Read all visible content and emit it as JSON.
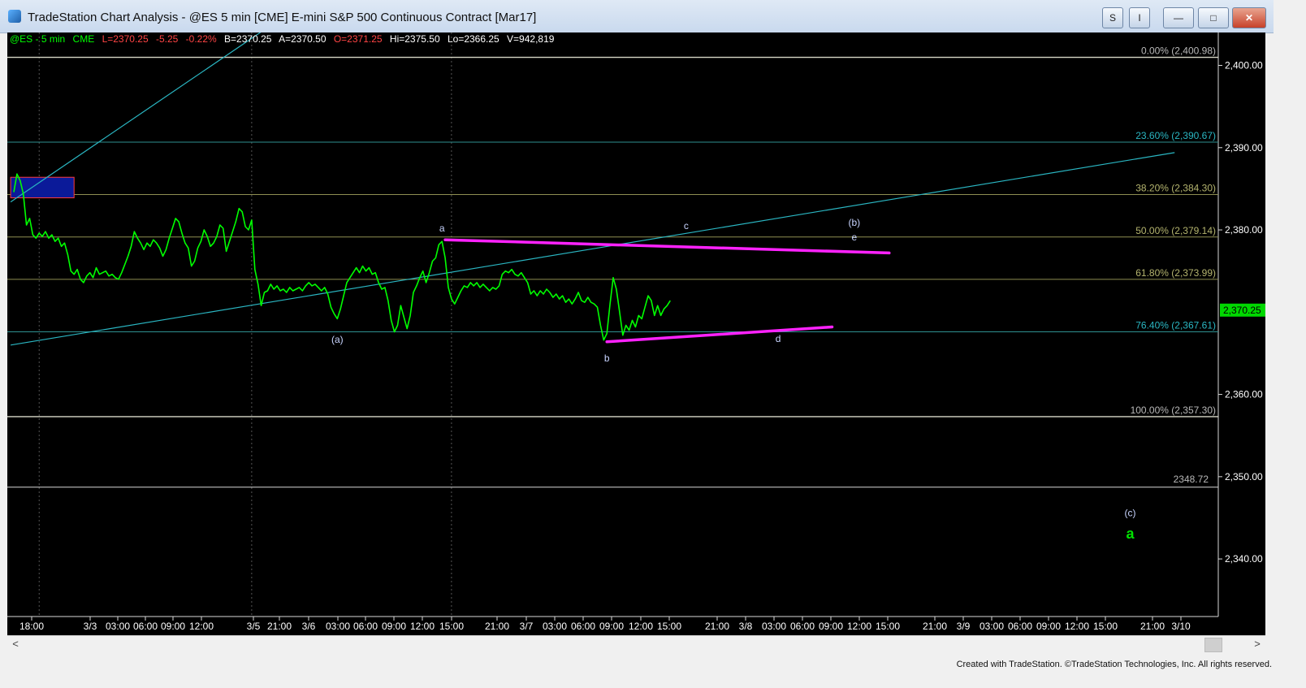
{
  "window": {
    "title": "TradeStation Chart Analysis - @ES 5 min [CME] E-mini S&P 500 Continuous Contract [Mar17]",
    "s_label": "S",
    "i_label": "I",
    "minimize_label": "—",
    "maximize_label": "□",
    "close_label": "✕"
  },
  "colors": {
    "price": "#00ff00",
    "trend": "#2ab6c2",
    "pink": "#ff22ff",
    "fib": "#b4b46e",
    "label": "#c8d4ff"
  },
  "header": {
    "symbol": "@ES - 5 min",
    "exchange": "CME",
    "last": "L=2370.25",
    "change": "-5.25",
    "pct": "-0.22%",
    "bid": "B=2370.25",
    "ask": "A=2370.50",
    "open": "O=2371.25",
    "high": "Hi=2375.50",
    "low": "Lo=2366.25",
    "volume": "V=942,819"
  },
  "scroll": {
    "left": "<",
    "right": ">"
  },
  "footer": {
    "text": "Created with TradeStation. ©TradeStation Technologies, Inc. All rights reserved."
  },
  "chart_data": {
    "type": "line",
    "ylim": [
      2333,
      2404
    ],
    "y_ticks": [
      {
        "value": 2400,
        "label": "2,400.00"
      },
      {
        "value": 2390,
        "label": "2,390.00"
      },
      {
        "value": 2380,
        "label": "2,380.00"
      },
      {
        "value": 2360,
        "label": "2,360.00"
      },
      {
        "value": 2350,
        "label": "2,350.00"
      },
      {
        "value": 2340,
        "label": "2,340.00"
      }
    ],
    "x_ticks": [
      "18:00",
      "3/3",
      "03:00",
      "06:00",
      "09:00",
      "12:00",
      "3/5",
      "21:00",
      "3/6",
      "03:00",
      "06:00",
      "09:00",
      "12:00",
      "15:00",
      "21:00",
      "3/7",
      "03:00",
      "06:00",
      "09:00",
      "12:00",
      "15:00",
      "21:00",
      "3/8",
      "03:00",
      "06:00",
      "09:00",
      "12:00",
      "15:00",
      "21:00",
      "3/9",
      "03:00",
      "06:00",
      "09:00",
      "12:00",
      "15:00",
      "21:00",
      "3/10"
    ],
    "last_price": {
      "value": 2370.25,
      "label": "2,370.25"
    },
    "fib_levels": [
      {
        "value": 2400.98,
        "label": "0.00% (2,400.98)"
      },
      {
        "value": 2390.67,
        "label": "23.60% (2,390.67)"
      },
      {
        "value": 2384.3,
        "label": "38.20% (2,384.30)"
      },
      {
        "value": 2379.14,
        "label": "50.00% (2,379.14)"
      },
      {
        "value": 2373.99,
        "label": "61.80% (2,373.99)"
      },
      {
        "value": 2367.61,
        "label": "76.40% (2,367.61)"
      },
      {
        "value": 2357.3,
        "label": "100.00% (2,357.30)"
      }
    ],
    "extra_level": {
      "value": 2348.72,
      "label": "2348.72"
    },
    "wave_labels": [
      {
        "text": "a",
        "bar": 135,
        "y": 2379.8
      },
      {
        "text": "(a)",
        "bar": 102,
        "y": 2366.3
      },
      {
        "text": "b",
        "bar": 187,
        "y": 2364.0
      },
      {
        "text": "c",
        "bar": 212,
        "y": 2380.1
      },
      {
        "text": "(b)",
        "bar": 265,
        "y": 2380.5
      },
      {
        "text": "e",
        "bar": 265,
        "y": 2378.7
      },
      {
        "text": "d",
        "bar": 241,
        "y": 2366.4
      },
      {
        "text": "(c)",
        "bar": 352,
        "y": 2345.2
      },
      {
        "text": "a",
        "bar": 352,
        "y": 2342.5
      }
    ],
    "price_series": [
      [
        0,
        2384.6
      ],
      [
        1,
        2386.8
      ],
      [
        2,
        2386.0
      ],
      [
        3,
        2384.4
      ],
      [
        4,
        2380.6
      ],
      [
        5,
        2381.4
      ],
      [
        6,
        2379.4
      ],
      [
        7,
        2379.0
      ],
      [
        8,
        2379.6
      ],
      [
        9,
        2379.2
      ],
      [
        10,
        2379.8
      ],
      [
        11,
        2379.0
      ],
      [
        12,
        2379.4
      ],
      [
        13,
        2378.6
      ],
      [
        14,
        2379.0
      ],
      [
        15,
        2378.0
      ],
      [
        16,
        2378.4
      ],
      [
        17,
        2377.0
      ],
      [
        18,
        2375.0
      ],
      [
        19,
        2374.6
      ],
      [
        20,
        2375.2
      ],
      [
        21,
        2374.0
      ],
      [
        22,
        2373.6
      ],
      [
        23,
        2374.4
      ],
      [
        24,
        2374.8
      ],
      [
        25,
        2374.2
      ],
      [
        26,
        2375.4
      ],
      [
        27,
        2374.6
      ],
      [
        28,
        2374.8
      ],
      [
        29,
        2375.0
      ],
      [
        30,
        2374.4
      ],
      [
        31,
        2374.6
      ],
      [
        32,
        2374.2
      ],
      [
        33,
        2374.0
      ],
      [
        34,
        2374.8
      ],
      [
        35,
        2375.8
      ],
      [
        36,
        2376.8
      ],
      [
        37,
        2378.0
      ],
      [
        38,
        2379.8
      ],
      [
        39,
        2379.0
      ],
      [
        40,
        2378.4
      ],
      [
        41,
        2377.6
      ],
      [
        42,
        2378.4
      ],
      [
        43,
        2378.0
      ],
      [
        44,
        2378.8
      ],
      [
        45,
        2378.4
      ],
      [
        46,
        2377.8
      ],
      [
        47,
        2376.8
      ],
      [
        48,
        2377.6
      ],
      [
        49,
        2379.0
      ],
      [
        50,
        2380.2
      ],
      [
        51,
        2381.4
      ],
      [
        52,
        2381.0
      ],
      [
        53,
        2379.6
      ],
      [
        54,
        2378.4
      ],
      [
        55,
        2377.8
      ],
      [
        56,
        2375.6
      ],
      [
        57,
        2376.2
      ],
      [
        58,
        2377.8
      ],
      [
        59,
        2378.6
      ],
      [
        60,
        2380.0
      ],
      [
        61,
        2379.2
      ],
      [
        62,
        2378.0
      ],
      [
        63,
        2378.4
      ],
      [
        64,
        2379.2
      ],
      [
        65,
        2380.6
      ],
      [
        66,
        2380.2
      ],
      [
        67,
        2377.4
      ],
      [
        68,
        2378.6
      ],
      [
        69,
        2379.8
      ],
      [
        70,
        2381.0
      ],
      [
        71,
        2382.6
      ],
      [
        72,
        2382.2
      ],
      [
        73,
        2380.4
      ],
      [
        74,
        2380.0
      ],
      [
        75,
        2381.2
      ],
      [
        76,
        2375.2
      ],
      [
        77,
        2373.4
      ],
      [
        78,
        2370.8
      ],
      [
        79,
        2372.4
      ],
      [
        80,
        2372.6
      ],
      [
        81,
        2373.4
      ],
      [
        82,
        2372.8
      ],
      [
        83,
        2373.2
      ],
      [
        84,
        2372.6
      ],
      [
        85,
        2372.8
      ],
      [
        86,
        2372.4
      ],
      [
        87,
        2373.0
      ],
      [
        88,
        2372.6
      ],
      [
        89,
        2372.8
      ],
      [
        90,
        2373.0
      ],
      [
        91,
        2372.6
      ],
      [
        92,
        2373.2
      ],
      [
        93,
        2373.6
      ],
      [
        94,
        2373.2
      ],
      [
        95,
        2373.4
      ],
      [
        96,
        2373.0
      ],
      [
        97,
        2372.6
      ],
      [
        98,
        2373.0
      ],
      [
        99,
        2372.2
      ],
      [
        100,
        2370.6
      ],
      [
        101,
        2369.8
      ],
      [
        102,
        2369.2
      ],
      [
        103,
        2370.4
      ],
      [
        104,
        2372.0
      ],
      [
        105,
        2373.6
      ],
      [
        106,
        2374.2
      ],
      [
        107,
        2374.8
      ],
      [
        108,
        2375.4
      ],
      [
        109,
        2374.8
      ],
      [
        110,
        2375.6
      ],
      [
        111,
        2375.0
      ],
      [
        112,
        2375.4
      ],
      [
        113,
        2374.6
      ],
      [
        114,
        2374.8
      ],
      [
        115,
        2373.6
      ],
      [
        116,
        2372.8
      ],
      [
        117,
        2373.0
      ],
      [
        118,
        2371.4
      ],
      [
        119,
        2369.0
      ],
      [
        120,
        2367.6
      ],
      [
        121,
        2368.4
      ],
      [
        122,
        2370.8
      ],
      [
        123,
        2369.4
      ],
      [
        124,
        2368.0
      ],
      [
        125,
        2369.6
      ],
      [
        126,
        2372.4
      ],
      [
        127,
        2373.2
      ],
      [
        128,
        2374.2
      ],
      [
        129,
        2375.0
      ],
      [
        130,
        2373.6
      ],
      [
        131,
        2374.8
      ],
      [
        132,
        2376.2
      ],
      [
        133,
        2376.6
      ],
      [
        134,
        2378.2
      ],
      [
        135,
        2378.6
      ],
      [
        136,
        2376.6
      ],
      [
        137,
        2373.0
      ],
      [
        138,
        2371.6
      ],
      [
        139,
        2371.0
      ],
      [
        140,
        2371.8
      ],
      [
        141,
        2372.6
      ],
      [
        142,
        2373.2
      ],
      [
        143,
        2373.0
      ],
      [
        144,
        2373.6
      ],
      [
        145,
        2373.2
      ],
      [
        146,
        2373.6
      ],
      [
        147,
        2373.0
      ],
      [
        148,
        2373.4
      ],
      [
        149,
        2373.0
      ],
      [
        150,
        2372.6
      ],
      [
        151,
        2373.0
      ],
      [
        152,
        2372.8
      ],
      [
        153,
        2373.2
      ],
      [
        154,
        2374.6
      ],
      [
        155,
        2375.0
      ],
      [
        156,
        2374.8
      ],
      [
        157,
        2375.2
      ],
      [
        158,
        2374.6
      ],
      [
        159,
        2374.4
      ],
      [
        160,
        2374.8
      ],
      [
        161,
        2374.2
      ],
      [
        162,
        2373.6
      ],
      [
        163,
        2372.2
      ],
      [
        164,
        2372.6
      ],
      [
        165,
        2372.0
      ],
      [
        166,
        2372.6
      ],
      [
        167,
        2372.2
      ],
      [
        168,
        2372.8
      ],
      [
        169,
        2372.4
      ],
      [
        170,
        2371.8
      ],
      [
        171,
        2372.2
      ],
      [
        172,
        2371.6
      ],
      [
        173,
        2372.0
      ],
      [
        174,
        2371.2
      ],
      [
        175,
        2371.6
      ],
      [
        176,
        2371.0
      ],
      [
        177,
        2371.6
      ],
      [
        178,
        2372.4
      ],
      [
        179,
        2371.4
      ],
      [
        180,
        2371.2
      ],
      [
        181,
        2371.8
      ],
      [
        182,
        2371.2
      ],
      [
        183,
        2371.0
      ],
      [
        184,
        2370.6
      ],
      [
        185,
        2368.4
      ],
      [
        186,
        2366.6
      ],
      [
        187,
        2367.4
      ],
      [
        188,
        2371.0
      ],
      [
        189,
        2374.2
      ],
      [
        190,
        2372.8
      ],
      [
        191,
        2370.0
      ],
      [
        192,
        2367.2
      ],
      [
        193,
        2368.4
      ],
      [
        194,
        2367.8
      ],
      [
        195,
        2369.0
      ],
      [
        196,
        2368.2
      ],
      [
        197,
        2369.6
      ],
      [
        198,
        2369.2
      ],
      [
        199,
        2370.6
      ],
      [
        200,
        2372.0
      ],
      [
        201,
        2371.4
      ],
      [
        202,
        2369.6
      ],
      [
        203,
        2370.8
      ],
      [
        204,
        2369.6
      ],
      [
        205,
        2370.4
      ],
      [
        206,
        2370.8
      ],
      [
        207,
        2371.4
      ]
    ],
    "trend_lines": [
      {
        "from": [
          -1,
          2383.4
        ],
        "to": [
          80,
          2404.6
        ]
      },
      {
        "from": [
          -1,
          2366.0
        ],
        "to": [
          366,
          2389.4
        ]
      }
    ],
    "triangle_lines": [
      {
        "from": [
          136,
          2378.8
        ],
        "to": [
          276,
          2377.2
        ]
      },
      {
        "from": [
          187,
          2366.4
        ],
        "to": [
          258,
          2368.2
        ]
      }
    ],
    "box": {
      "from": [
        -1,
        2383.9
      ],
      "to": [
        19,
        2386.4
      ]
    },
    "vertical_gridlines": [
      8,
      75,
      138
    ]
  }
}
